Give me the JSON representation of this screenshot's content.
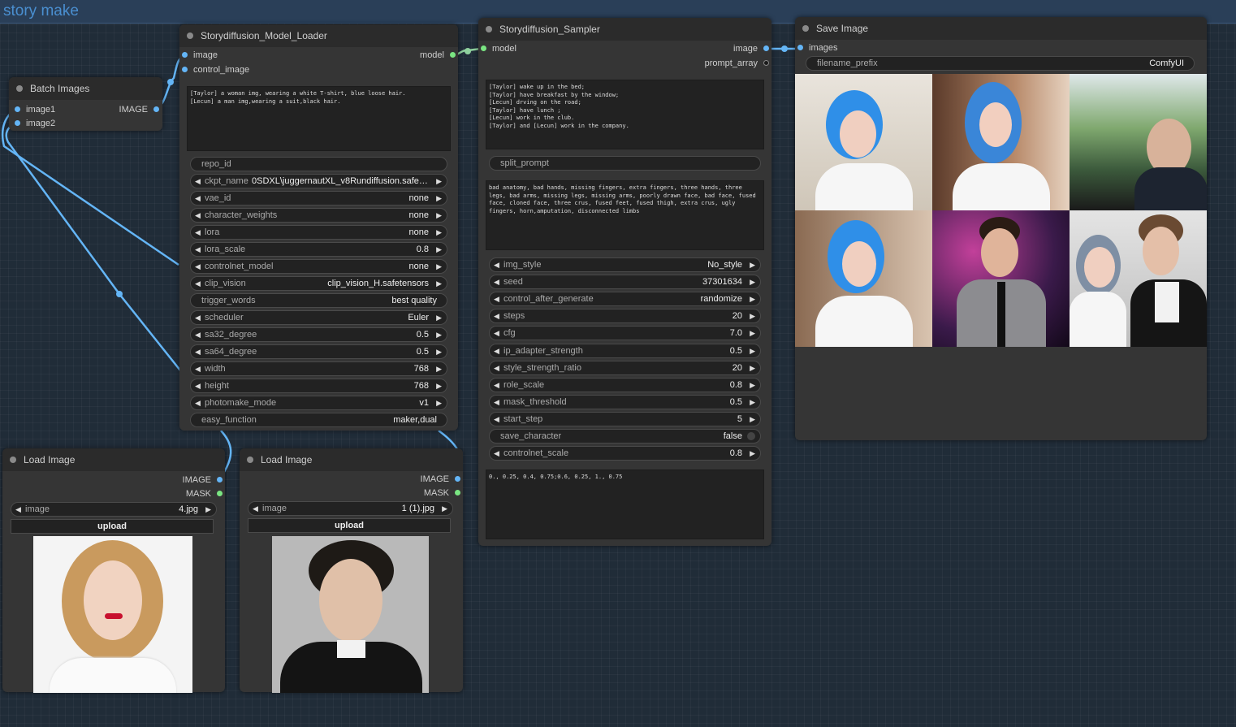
{
  "group": {
    "title": "story make"
  },
  "batch": {
    "title": "Batch Images",
    "inputs": [
      "image1",
      "image2"
    ],
    "output": "IMAGE"
  },
  "loader": {
    "title": "Storydiffusion_Model_Loader",
    "inputs": [
      "image",
      "control_image"
    ],
    "output": "model",
    "prompt": "[Taylor] a woman img, wearing a white T-shirt, blue loose hair.\n[Lecun] a man img,wearing a suit,black hair.",
    "widgets": [
      {
        "label": "repo_id",
        "value": "",
        "type": "text"
      },
      {
        "label": "ckpt_name",
        "value": "0SDXL\\juggernautXL_v8Rundiffusion.safet...",
        "type": "combo-left"
      },
      {
        "label": "vae_id",
        "value": "none",
        "type": "combo"
      },
      {
        "label": "character_weights",
        "value": "none",
        "type": "combo"
      },
      {
        "label": "lora",
        "value": "none",
        "type": "combo"
      },
      {
        "label": "lora_scale",
        "value": "0.8",
        "type": "combo"
      },
      {
        "label": "controlnet_model",
        "value": "none",
        "type": "combo"
      },
      {
        "label": "clip_vision",
        "value": "clip_vision_H.safetensors",
        "type": "combo"
      },
      {
        "label": "trigger_words",
        "value": "best quality",
        "type": "text"
      },
      {
        "label": "scheduler",
        "value": "Euler",
        "type": "combo"
      },
      {
        "label": "sa32_degree",
        "value": "0.5",
        "type": "combo"
      },
      {
        "label": "sa64_degree",
        "value": "0.5",
        "type": "combo"
      },
      {
        "label": "width",
        "value": "768",
        "type": "combo"
      },
      {
        "label": "height",
        "value": "768",
        "type": "combo"
      },
      {
        "label": "photomake_mode",
        "value": "v1",
        "type": "combo"
      },
      {
        "label": "easy_function",
        "value": "maker,dual",
        "type": "text"
      }
    ]
  },
  "sampler": {
    "title": "Storydiffusion_Sampler",
    "input": "model",
    "outputs": [
      "image",
      "prompt_array"
    ],
    "prompt": "[Taylor] wake up in the bed;\n[Taylor] have breakfast by the window;\n[Lecun] drving on the road;\n[Taylor] have lunch ;\n[Lecun] work in the club.\n[Taylor] and [Lecun] work in the company.",
    "split_label": "split_prompt",
    "negative": "bad anatomy, bad hands, missing fingers, extra fingers, three hands, three legs, bad arms, missing legs, missing arms, poorly drawn face, bad face, fused face, cloned face, three crus, fused feet, fused thigh, extra crus, ugly fingers, horn,amputation, disconnected limbs",
    "widgets": [
      {
        "label": "img_style",
        "value": "No_style",
        "type": "combo"
      },
      {
        "label": "seed",
        "value": "37301634",
        "type": "combo"
      },
      {
        "label": "control_after_generate",
        "value": "randomize",
        "type": "combo"
      },
      {
        "label": "steps",
        "value": "20",
        "type": "combo"
      },
      {
        "label": "cfg",
        "value": "7.0",
        "type": "combo"
      },
      {
        "label": "ip_adapter_strength",
        "value": "0.5",
        "type": "combo"
      },
      {
        "label": "style_strength_ratio",
        "value": "20",
        "type": "combo"
      },
      {
        "label": "role_scale",
        "value": "0.8",
        "type": "combo"
      },
      {
        "label": "mask_threshold",
        "value": "0.5",
        "type": "combo"
      },
      {
        "label": "start_step",
        "value": "5",
        "type": "combo"
      },
      {
        "label": "save_character",
        "value": "false",
        "type": "toggle"
      },
      {
        "label": "controlnet_scale",
        "value": "0.8",
        "type": "combo"
      }
    ],
    "schedule": "0., 0.25, 0.4, 0.75;0.6, 0.25, 1., 0.75"
  },
  "save": {
    "title": "Save Image",
    "input": "images",
    "filename_label": "filename_prefix",
    "filename_value": "ComfyUI"
  },
  "load1": {
    "title": "Load Image",
    "outputs": [
      "IMAGE",
      "MASK"
    ],
    "image_label": "image",
    "image_value": "4.jpg",
    "upload": "upload"
  },
  "load2": {
    "title": "Load Image",
    "outputs": [
      "IMAGE",
      "MASK"
    ],
    "image_label": "image",
    "image_value": "1 (1).jpg",
    "upload": "upload"
  }
}
